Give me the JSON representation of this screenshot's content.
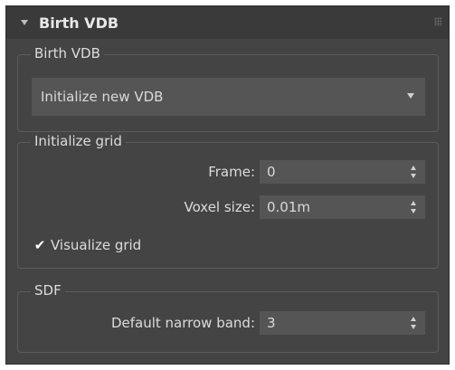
{
  "rollout": {
    "title": "Birth VDB",
    "grip_icon": "grip-dots-icon",
    "collapse_icon": "collapse-arrow-icon"
  },
  "groups": {
    "birth": {
      "title": "Birth VDB",
      "dropdown": {
        "value": "Initialize new VDB",
        "icon": "chevron-down-icon"
      }
    },
    "init_grid": {
      "title": "Initialize grid",
      "frame": {
        "label": "Frame:",
        "value": "0"
      },
      "voxel_size": {
        "label": "Voxel size:",
        "value": "0.01m"
      },
      "visualize": {
        "label": "Visualize grid",
        "checked": true
      }
    },
    "sdf": {
      "title": "SDF",
      "narrow_band": {
        "label": "Default narrow band:",
        "value": "3"
      }
    }
  },
  "colors": {
    "panel_bg": "#444444",
    "header_bg": "#3a3a3a",
    "field_bg": "#555555",
    "text": "#dcdcdc"
  }
}
